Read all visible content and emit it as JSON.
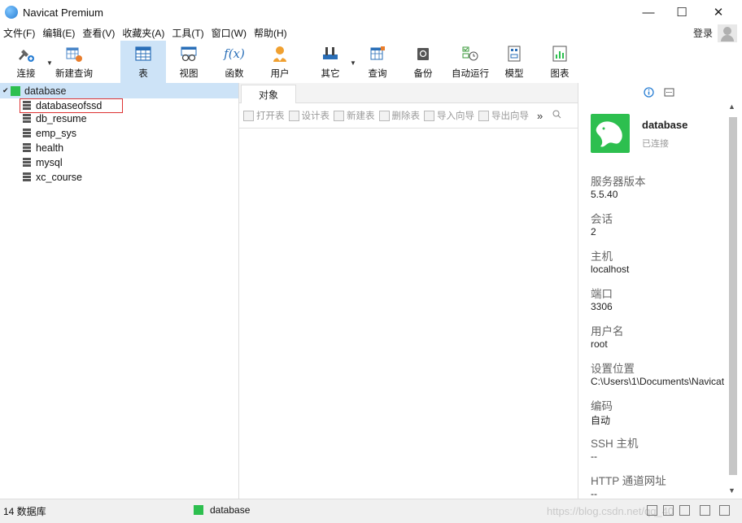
{
  "window": {
    "title": "Navicat Premium",
    "controls": [
      "—",
      "☐",
      "✕"
    ]
  },
  "menu": {
    "items": [
      "文件(F)",
      "编辑(E)",
      "查看(V)",
      "收藏夹(A)",
      "工具(T)",
      "窗口(W)",
      "帮助(H)"
    ],
    "login": "登录"
  },
  "toolbar": {
    "buttons": [
      {
        "label": "连接",
        "icon": "connect-icon"
      },
      {
        "label": "新建查询",
        "icon": "new-query-icon"
      },
      {
        "label": "表",
        "icon": "table-icon",
        "active": true
      },
      {
        "label": "视图",
        "icon": "view-icon"
      },
      {
        "label": "函数",
        "icon": "function-icon",
        "glyph": "f(x)"
      },
      {
        "label": "用户",
        "icon": "user-icon"
      },
      {
        "label": "其它",
        "icon": "other-icon"
      },
      {
        "label": "查询",
        "icon": "query-icon"
      },
      {
        "label": "备份",
        "icon": "backup-icon"
      },
      {
        "label": "自动运行",
        "icon": "automation-icon"
      },
      {
        "label": "模型",
        "icon": "model-icon"
      },
      {
        "label": "图表",
        "icon": "chart-icon"
      }
    ]
  },
  "tree": {
    "root": "database",
    "databases": [
      "databaseofssd",
      "db_resume",
      "emp_sys",
      "health",
      "mysql",
      "xc_course"
    ]
  },
  "objects": {
    "tab_label": "对象",
    "actions": [
      "打开表",
      "设计表",
      "新建表",
      "删除表",
      "导入向导",
      "导出向导"
    ],
    "more": "»"
  },
  "info": {
    "name": "database",
    "status": "已连接",
    "properties": [
      {
        "label": "服务器版本",
        "value": "5.5.40"
      },
      {
        "label": "会话",
        "value": "2"
      },
      {
        "label": "主机",
        "value": "localhost"
      },
      {
        "label": "端口",
        "value": "3306"
      },
      {
        "label": "用户名",
        "value": "root"
      },
      {
        "label": "设置位置",
        "value": "C:\\Users\\1\\Documents\\Navicat"
      },
      {
        "label": "编码",
        "value": "自动"
      },
      {
        "label": "SSH 主机",
        "value": "--"
      },
      {
        "label": "HTTP 通道网址",
        "value": "--"
      }
    ]
  },
  "status": {
    "count": "14 数据库",
    "current": "database",
    "watermark": "https://blog.csdn.net/qq_40"
  },
  "colors": {
    "accent": "#cde3f7",
    "connection_green": "#2dbf4f",
    "selection_border": "#dd3333"
  }
}
